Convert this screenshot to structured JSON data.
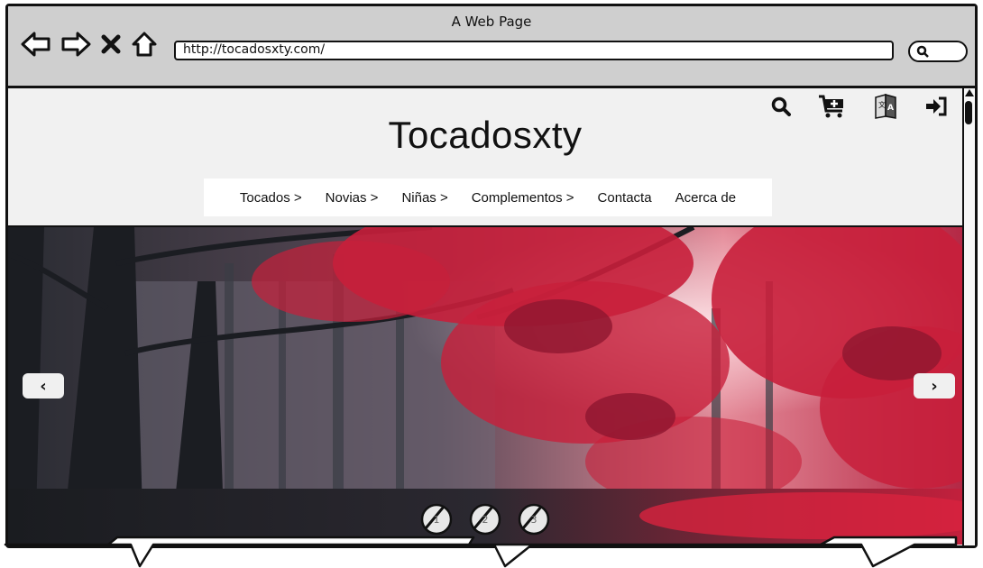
{
  "window": {
    "title": "A Web Page"
  },
  "address_bar": {
    "url": "http://tocadosxty.com/"
  },
  "toolbar": {
    "icons": [
      "back-arrow-icon",
      "forward-arrow-icon",
      "stop-icon",
      "home-icon"
    ],
    "search_icon": "search-icon"
  },
  "site": {
    "title": "Tocadosxty",
    "header_icons": [
      "search-icon",
      "cart-add-icon",
      "language-icon",
      "sign-in-icon"
    ]
  },
  "menu": {
    "items": [
      {
        "label": "Tocados >"
      },
      {
        "label": "Novias >"
      },
      {
        "label": "Niñas >"
      },
      {
        "label": "Complementos >"
      },
      {
        "label": "Contacta"
      },
      {
        "label": "Acerca de"
      }
    ]
  },
  "carousel": {
    "prev_label": "‹",
    "next_label": "›",
    "pages": [
      {
        "label": "1"
      },
      {
        "label": "2"
      },
      {
        "label": "3"
      }
    ],
    "colors": {
      "foliage": "#c81f3b",
      "shadow": "#1e2126",
      "mist": "#6e6a78"
    }
  }
}
